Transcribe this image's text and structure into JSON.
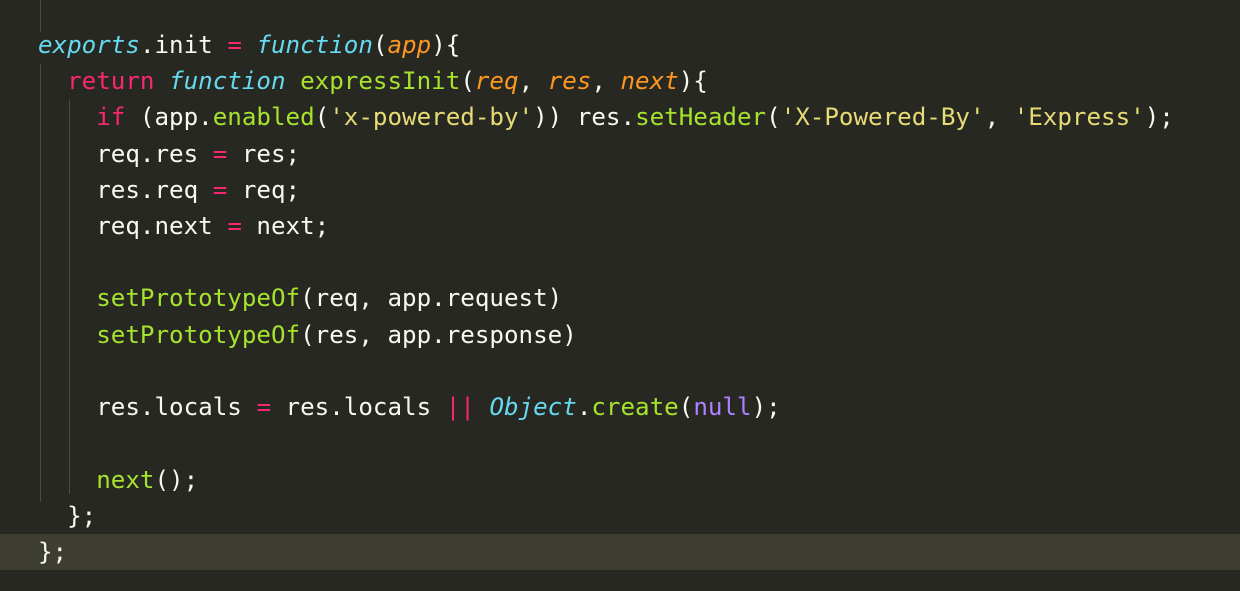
{
  "editor": {
    "theme_colors": {
      "background": "#272822",
      "current_line": "#3e3d32",
      "keyword": "#f92672",
      "storage": "#66d9ef",
      "function": "#a6e22e",
      "parameter": "#fd971f",
      "string": "#e6db74",
      "constant": "#ae81ff",
      "text": "#f8f8f2"
    },
    "lines": [
      [
        {
          "t": "exports",
          "c": "st"
        },
        {
          "t": ".init ",
          "c": "nm"
        },
        {
          "t": "=",
          "c": "kw"
        },
        {
          "t": " ",
          "c": "nm"
        },
        {
          "t": "function",
          "c": "st"
        },
        {
          "t": "(",
          "c": "nm"
        },
        {
          "t": "app",
          "c": "pa"
        },
        {
          "t": "){",
          "c": "nm"
        }
      ],
      [
        {
          "t": "  ",
          "c": "nm"
        },
        {
          "t": "return",
          "c": "kw"
        },
        {
          "t": " ",
          "c": "nm"
        },
        {
          "t": "function",
          "c": "st"
        },
        {
          "t": " ",
          "c": "nm"
        },
        {
          "t": "expressInit",
          "c": "fn"
        },
        {
          "t": "(",
          "c": "nm"
        },
        {
          "t": "req",
          "c": "pa"
        },
        {
          "t": ", ",
          "c": "nm"
        },
        {
          "t": "res",
          "c": "pa"
        },
        {
          "t": ", ",
          "c": "nm"
        },
        {
          "t": "next",
          "c": "pa"
        },
        {
          "t": "){",
          "c": "nm"
        }
      ],
      [
        {
          "t": "    ",
          "c": "nm"
        },
        {
          "t": "if",
          "c": "kw"
        },
        {
          "t": " (app.",
          "c": "nm"
        },
        {
          "t": "enabled",
          "c": "fn"
        },
        {
          "t": "(",
          "c": "nm"
        },
        {
          "t": "'x-powered-by'",
          "c": "str"
        },
        {
          "t": ")) res.",
          "c": "nm"
        },
        {
          "t": "setHeader",
          "c": "fn"
        },
        {
          "t": "(",
          "c": "nm"
        },
        {
          "t": "'X-Powered-By'",
          "c": "str"
        },
        {
          "t": ", ",
          "c": "nm"
        },
        {
          "t": "'Express'",
          "c": "str"
        },
        {
          "t": ");",
          "c": "nm"
        }
      ],
      [
        {
          "t": "    req.res ",
          "c": "nm"
        },
        {
          "t": "=",
          "c": "kw"
        },
        {
          "t": " res;",
          "c": "nm"
        }
      ],
      [
        {
          "t": "    res.req ",
          "c": "nm"
        },
        {
          "t": "=",
          "c": "kw"
        },
        {
          "t": " req;",
          "c": "nm"
        }
      ],
      [
        {
          "t": "    req.next ",
          "c": "nm"
        },
        {
          "t": "=",
          "c": "kw"
        },
        {
          "t": " next;",
          "c": "nm"
        }
      ],
      [],
      [
        {
          "t": "    ",
          "c": "nm"
        },
        {
          "t": "setPrototypeOf",
          "c": "fn"
        },
        {
          "t": "(req, app.request)",
          "c": "nm"
        }
      ],
      [
        {
          "t": "    ",
          "c": "nm"
        },
        {
          "t": "setPrototypeOf",
          "c": "fn"
        },
        {
          "t": "(res, app.response)",
          "c": "nm"
        }
      ],
      [],
      [
        {
          "t": "    res.locals ",
          "c": "nm"
        },
        {
          "t": "=",
          "c": "kw"
        },
        {
          "t": " res.locals ",
          "c": "nm"
        },
        {
          "t": "||",
          "c": "kw"
        },
        {
          "t": " ",
          "c": "nm"
        },
        {
          "t": "Object",
          "c": "st"
        },
        {
          "t": ".",
          "c": "nm"
        },
        {
          "t": "create",
          "c": "fn"
        },
        {
          "t": "(",
          "c": "nm"
        },
        {
          "t": "null",
          "c": "cst"
        },
        {
          "t": ");",
          "c": "nm"
        }
      ],
      [],
      [
        {
          "t": "    ",
          "c": "nm"
        },
        {
          "t": "next",
          "c": "fn"
        },
        {
          "t": "();",
          "c": "nm"
        }
      ],
      [
        {
          "t": "  };",
          "c": "nm"
        }
      ],
      [
        {
          "t": "};",
          "c": "nm"
        }
      ]
    ],
    "current_line_index": 14
  }
}
